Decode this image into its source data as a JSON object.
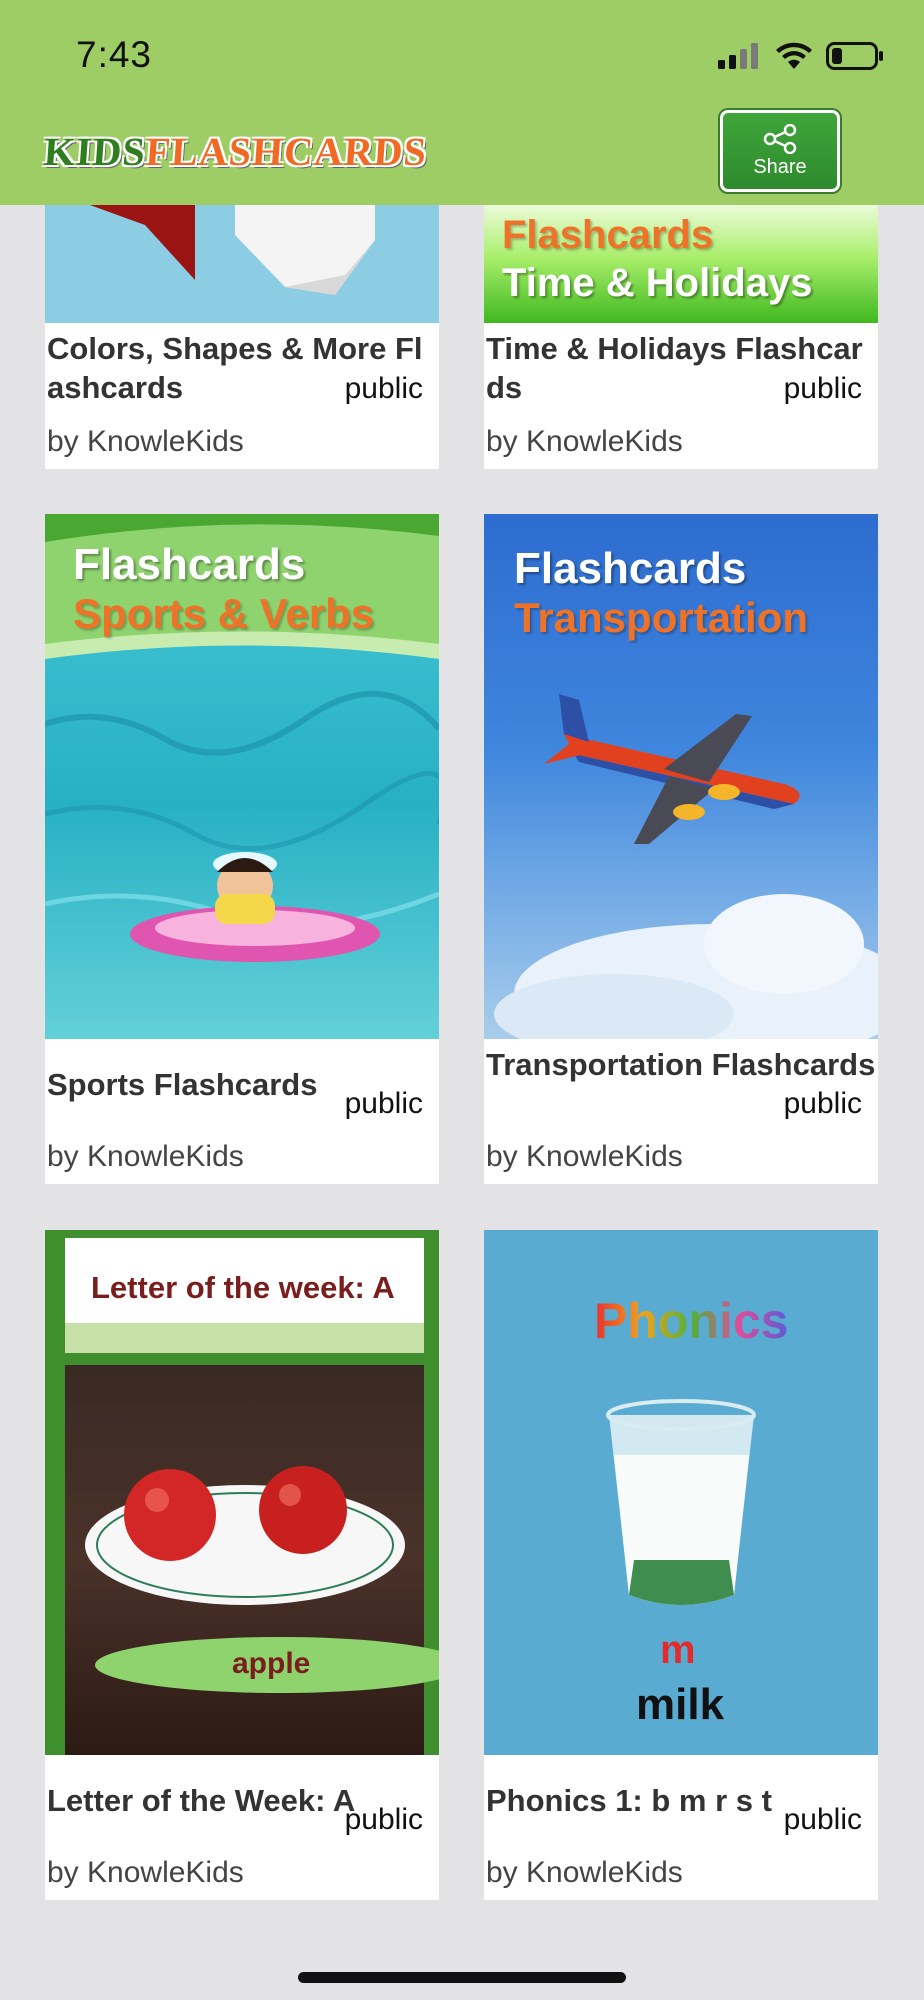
{
  "status_bar": {
    "time": "7:43"
  },
  "header": {
    "logo_text_1": "KIDS",
    "logo_text_2": "FLASHCARDS",
    "share_label": "Share"
  },
  "cards": [
    {
      "title": "Colors, Shapes & More Flashcards",
      "visibility": "public",
      "author": "by KnowleKids",
      "cover_line_1": "",
      "cover_line_2": ""
    },
    {
      "title": "Time & Holidays Flashcards",
      "visibility": "public",
      "author": "by KnowleKids",
      "cover_line_1": "Flashcards",
      "cover_line_2": "Time & Holidays"
    },
    {
      "title": "Sports Flashcards",
      "visibility": "public",
      "author": "by KnowleKids",
      "cover_line_1": "Flashcards",
      "cover_line_2": "Sports & Verbs"
    },
    {
      "title": "Transportation Flashcards",
      "visibility": "public",
      "author": "by KnowleKids",
      "cover_line_1": "Flashcards",
      "cover_line_2": "Transportation"
    },
    {
      "title": "Letter of the Week: A",
      "visibility": "public",
      "author": "by KnowleKids",
      "cover_line_1": "Letter of the week: A",
      "cover_line_2": "apple"
    },
    {
      "title": "Phonics 1: b m r s t",
      "visibility": "public",
      "author": "by KnowleKids",
      "cover_line_1": "Phonics",
      "cover_line_2": "m",
      "cover_line_3": "milk"
    }
  ]
}
